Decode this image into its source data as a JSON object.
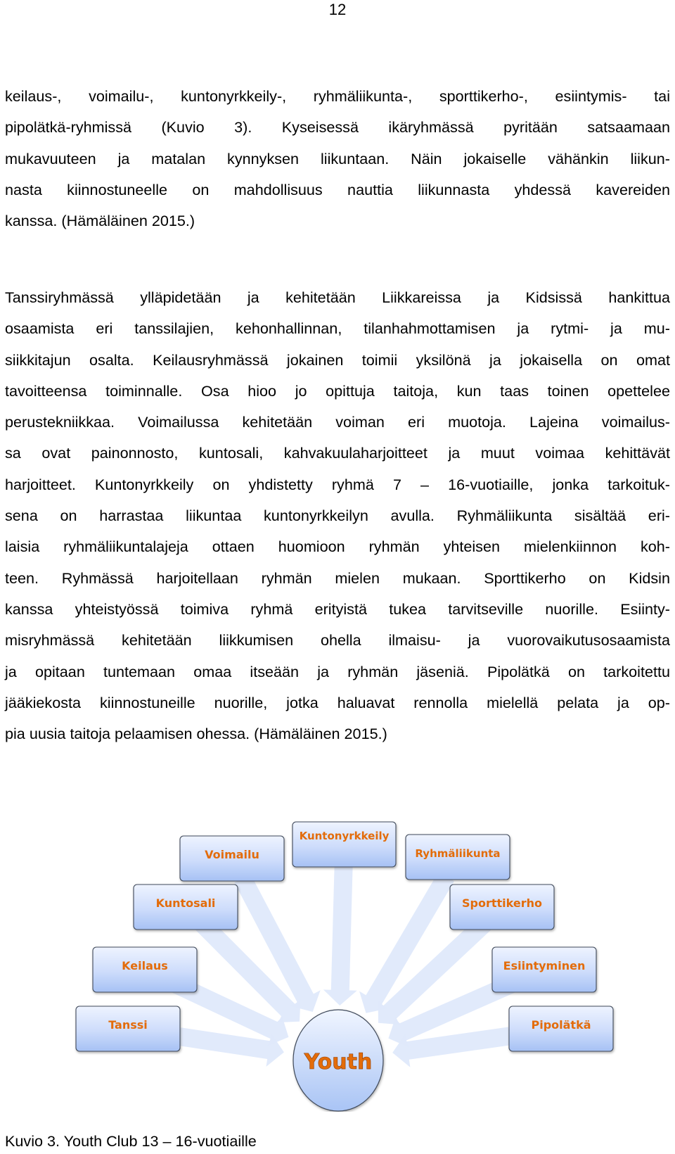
{
  "page_number": "12",
  "paragraphs": [
    {
      "lines": [
        "keilaus-, voimailu-, kuntonyrkkeily-, ryhmäliikunta-, sporttikerho-, esiintymis- tai",
        "pipolätkä-ryhmissä (Kuvio 3). Kyseisessä ikäryhmässä pyritään satsaamaan",
        "mukavuuteen ja matalan kynnyksen liikuntaan. Näin jokaiselle vähänkin liikun-",
        "nasta kiinnostuneelle on mahdollisuus nauttia liikunnasta yhdessä kavereiden",
        "kanssa. (Hämäläinen 2015.)"
      ]
    },
    {
      "lines": [
        "Tanssiryhmässä ylläpidetään ja kehitetään Liikkareissa ja Kidsissä hankittua",
        "osaamista eri tanssilajien, kehonhallinnan, tilanhahmottamisen ja rytmi- ja mu-",
        "siikkitajun osalta. Keilausryhmässä jokainen toimii yksilönä ja jokaisella on omat",
        "tavoitteensa toiminnalle. Osa hioo jo opittuja taitoja, kun taas toinen opettelee",
        "perustekniikkaa. Voimailussa kehitetään voiman eri muotoja. Lajeina voimailus-",
        "sa ovat painonnosto, kuntosali, kahvakuulaharjoitteet ja muut voimaa kehittävät",
        "harjoitteet. Kuntonyrkkeily on yhdistetty ryhmä 7 – 16-vuotiaille, jonka tarkoituk-",
        "sena on harrastaa liikuntaa kuntonyrkkeilyn avulla. Ryhmäliikunta sisältää eri-",
        "laisia ryhmäliikuntalajeja ottaen huomioon ryhmän yhteisen mielenkiinnon koh-",
        "teen. Ryhmässä harjoitellaan ryhmän mielen mukaan. Sporttikerho on Kidsin",
        "kanssa yhteistyössä toimiva ryhmä erityistä tukea tarvitseville nuorille. Esiinty-",
        "misryhmässä kehitetään liikkumisen ohella ilmaisu- ja vuorovaikutusosaamista",
        "ja opitaan tuntemaan omaa itseään ja ryhmän jäseniä. Pipolätkä on tarkoitettu",
        "jääkiekosta kiinnostuneille nuorille, jotka haluavat rennolla mielellä pelata ja op-",
        "pia uusia taitoja pelaamisen ohessa. (Hämäläinen 2015.)"
      ]
    }
  ],
  "diagram": {
    "center_label": "Youth",
    "nodes": [
      "Tanssi",
      "Keilaus",
      "Kuntosali",
      "Voimailu",
      "Kuntonyrkkeily",
      "Ryhmäliikunta",
      "Sporttikerho",
      "Esiintyminen",
      "Pipolätkä"
    ],
    "colors": {
      "label_text": "#e36c0a",
      "box_fill_top": "#eaf1ff",
      "box_fill_bottom": "#a9c4f5",
      "box_border": "#3f4a5a",
      "arrow_fill": "#dde8fb"
    }
  },
  "caption": "Kuvio 3. Youth Club 13 – 16-vuotiaille"
}
